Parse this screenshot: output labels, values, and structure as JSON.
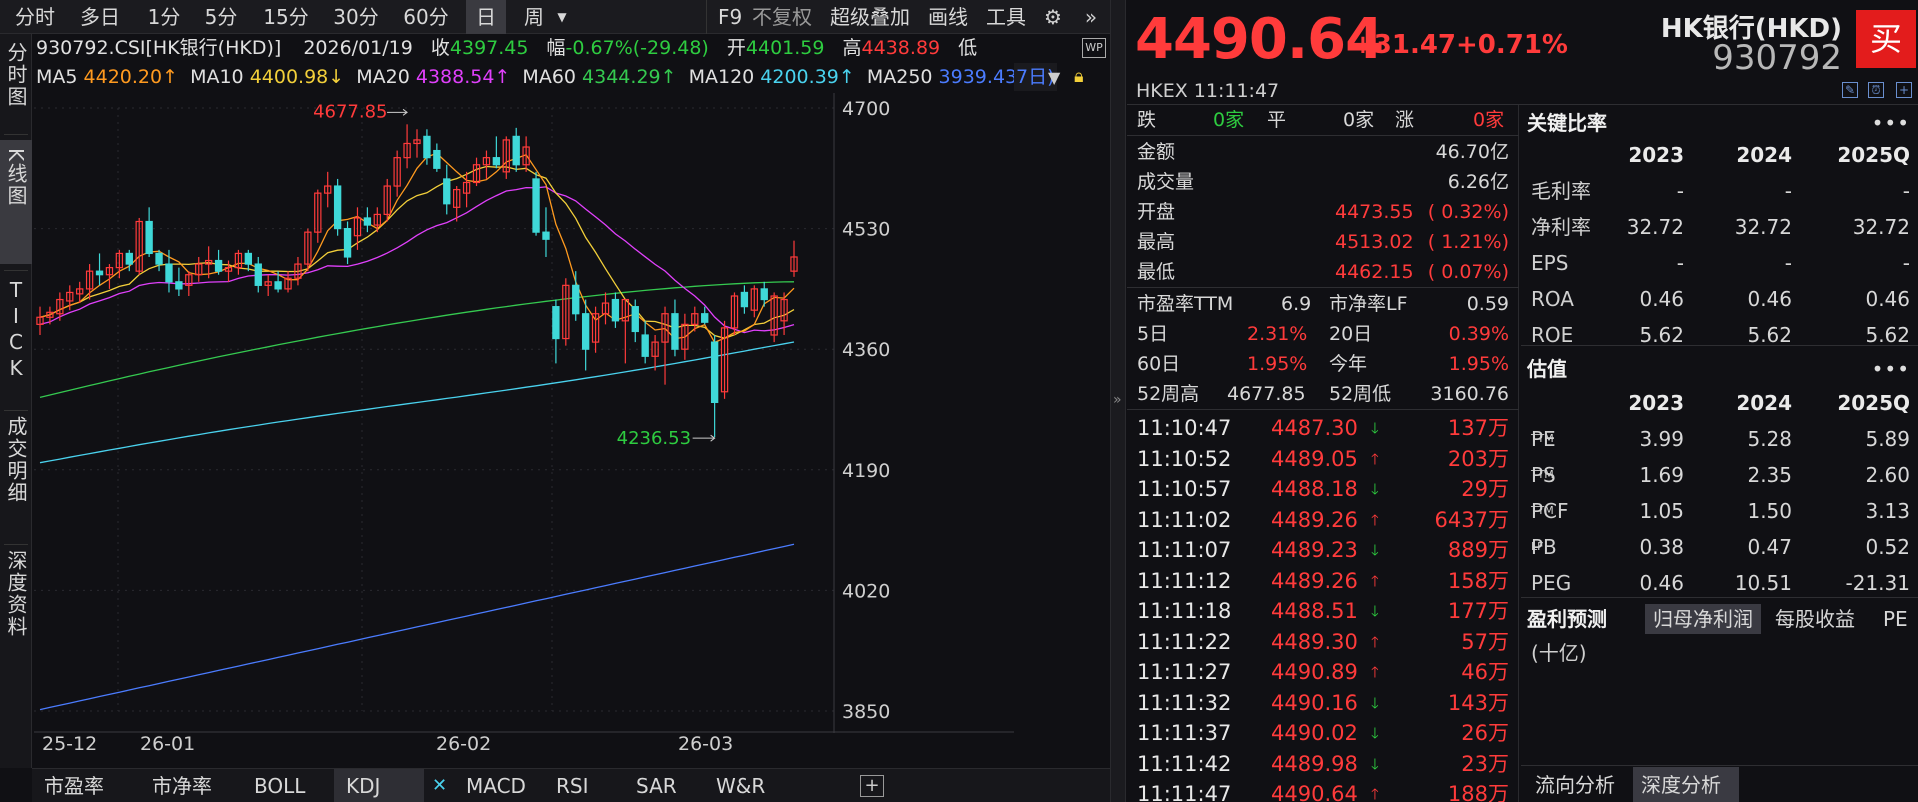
{
  "toolbar": {
    "periods": [
      "分时",
      "多日",
      "1分",
      "5分",
      "15分",
      "30分",
      "60分",
      "日",
      "周"
    ],
    "active_period": "日",
    "f9": "F9",
    "restore": "不复权",
    "overlay": "超级叠加",
    "draw": "画线",
    "tools": "工具"
  },
  "side_tabs": [
    "分时图",
    "K线图",
    "TICK",
    "成交明细",
    "深度资料"
  ],
  "info_line": {
    "code": "930792.CSI[HK银行(HKD)]",
    "date": "2026/01/19",
    "close_label": "收",
    "close": "4397.45",
    "range_label": "幅",
    "range": "-0.67%(-29.48)",
    "open_label": "开",
    "open": "4401.59",
    "high_label": "高",
    "high": "4438.89",
    "low_label": "低"
  },
  "ma_line": {
    "ma5_label": "MA5",
    "ma5": "4420.20↑",
    "ma10_label": "MA10",
    "ma10": "4400.98↓",
    "ma20_label": "MA20",
    "ma20": "4388.54↑",
    "ma60_label": "MA60",
    "ma60": "4344.29↑",
    "ma120_label": "MA120",
    "ma120": "4200.39↑",
    "ma250_label": "MA250",
    "ma250": "3939.43↑",
    "tail": "7日)"
  },
  "colors": {
    "red": "#ff3b3b",
    "green": "#2ecc40",
    "ma5": "#ff9a1f",
    "ma10": "#f2cf3a",
    "ma20": "#e040fb",
    "ma60": "#35c950",
    "ma120": "#4ad2ee",
    "ma250": "#4b7cff",
    "candle_up": "#ff3b3b",
    "candle_down": "#3fd8d8"
  },
  "chart_data": {
    "type": "candlestick",
    "y_ticks": [
      "4700",
      "4530",
      "4360",
      "4190",
      "4020",
      "3850"
    ],
    "ylim": [
      3850,
      4700
    ],
    "x_ticks": [
      "25-12",
      "26-01",
      "26-02",
      "26-03"
    ],
    "max_label": "4677.85",
    "min_label": "4236.53",
    "candles": [
      {
        "o": 4395,
        "h": 4420,
        "l": 4380,
        "c": 4405
      },
      {
        "o": 4405,
        "h": 4420,
        "l": 4395,
        "c": 4412
      },
      {
        "o": 4410,
        "h": 4440,
        "l": 4400,
        "c": 4430
      },
      {
        "o": 4428,
        "h": 4450,
        "l": 4415,
        "c": 4440
      },
      {
        "o": 4438,
        "h": 4455,
        "l": 4425,
        "c": 4445
      },
      {
        "o": 4445,
        "h": 4480,
        "l": 4430,
        "c": 4470
      },
      {
        "o": 4470,
        "h": 4495,
        "l": 4450,
        "c": 4465
      },
      {
        "o": 4465,
        "h": 4480,
        "l": 4445,
        "c": 4475
      },
      {
        "o": 4475,
        "h": 4500,
        "l": 4460,
        "c": 4495
      },
      {
        "o": 4495,
        "h": 4500,
        "l": 4470,
        "c": 4480
      },
      {
        "o": 4470,
        "h": 4545,
        "l": 4465,
        "c": 4540
      },
      {
        "o": 4540,
        "h": 4560,
        "l": 4490,
        "c": 4495
      },
      {
        "o": 4495,
        "h": 4500,
        "l": 4470,
        "c": 4480
      },
      {
        "o": 4480,
        "h": 4500,
        "l": 4440,
        "c": 4455
      },
      {
        "o": 4455,
        "h": 4475,
        "l": 4435,
        "c": 4445
      },
      {
        "o": 4450,
        "h": 4470,
        "l": 4435,
        "c": 4465
      },
      {
        "o": 4465,
        "h": 4490,
        "l": 4455,
        "c": 4480
      },
      {
        "o": 4480,
        "h": 4505,
        "l": 4460,
        "c": 4485
      },
      {
        "o": 4485,
        "h": 4500,
        "l": 4465,
        "c": 4470
      },
      {
        "o": 4470,
        "h": 4485,
        "l": 4455,
        "c": 4475
      },
      {
        "o": 4475,
        "h": 4500,
        "l": 4465,
        "c": 4495
      },
      {
        "o": 4495,
        "h": 4500,
        "l": 4470,
        "c": 4480
      },
      {
        "o": 4480,
        "h": 4490,
        "l": 4440,
        "c": 4450
      },
      {
        "o": 4450,
        "h": 4465,
        "l": 4435,
        "c": 4455
      },
      {
        "o": 4455,
        "h": 4470,
        "l": 4440,
        "c": 4445
      },
      {
        "o": 4445,
        "h": 4470,
        "l": 4440,
        "c": 4460
      },
      {
        "o": 4460,
        "h": 4490,
        "l": 4450,
        "c": 4480
      },
      {
        "o": 4480,
        "h": 4530,
        "l": 4470,
        "c": 4525
      },
      {
        "o": 4525,
        "h": 4585,
        "l": 4510,
        "c": 4580
      },
      {
        "o": 4580,
        "h": 4610,
        "l": 4560,
        "c": 4590
      },
      {
        "o": 4590,
        "h": 4600,
        "l": 4520,
        "c": 4530
      },
      {
        "o": 4530,
        "h": 4540,
        "l": 4480,
        "c": 4490
      },
      {
        "o": 4520,
        "h": 4560,
        "l": 4500,
        "c": 4545
      },
      {
        "o": 4545,
        "h": 4560,
        "l": 4525,
        "c": 4535
      },
      {
        "o": 4535,
        "h": 4560,
        "l": 4525,
        "c": 4550
      },
      {
        "o": 4550,
        "h": 4600,
        "l": 4540,
        "c": 4590
      },
      {
        "o": 4590,
        "h": 4640,
        "l": 4575,
        "c": 4630
      },
      {
        "o": 4630,
        "h": 4677,
        "l": 4615,
        "c": 4650
      },
      {
        "o": 4650,
        "h": 4670,
        "l": 4630,
        "c": 4655
      },
      {
        "o": 4660,
        "h": 4670,
        "l": 4620,
        "c": 4630
      },
      {
        "o": 4640,
        "h": 4650,
        "l": 4610,
        "c": 4615
      },
      {
        "o": 4600,
        "h": 4620,
        "l": 4550,
        "c": 4565
      },
      {
        "o": 4560,
        "h": 4590,
        "l": 4540,
        "c": 4585
      },
      {
        "o": 4580,
        "h": 4610,
        "l": 4560,
        "c": 4595
      },
      {
        "o": 4595,
        "h": 4630,
        "l": 4590,
        "c": 4620
      },
      {
        "o": 4620,
        "h": 4640,
        "l": 4600,
        "c": 4630
      },
      {
        "o": 4630,
        "h": 4660,
        "l": 4615,
        "c": 4620
      },
      {
        "o": 4610,
        "h": 4660,
        "l": 4600,
        "c": 4655
      },
      {
        "o": 4660,
        "h": 4672,
        "l": 4610,
        "c": 4620
      },
      {
        "o": 4620,
        "h": 4660,
        "l": 4610,
        "c": 4645
      },
      {
        "o": 4600,
        "h": 4610,
        "l": 4520,
        "c": 4525
      },
      {
        "o": 4525,
        "h": 4560,
        "l": 4490,
        "c": 4515
      },
      {
        "o": 4420,
        "h": 4430,
        "l": 4340,
        "c": 4375
      },
      {
        "o": 4375,
        "h": 4460,
        "l": 4365,
        "c": 4450
      },
      {
        "o": 4450,
        "h": 4470,
        "l": 4400,
        "c": 4410
      },
      {
        "o": 4410,
        "h": 4430,
        "l": 4330,
        "c": 4360
      },
      {
        "o": 4370,
        "h": 4420,
        "l": 4355,
        "c": 4410
      },
      {
        "o": 4410,
        "h": 4440,
        "l": 4395,
        "c": 4425
      },
      {
        "o": 4430,
        "h": 4440,
        "l": 4390,
        "c": 4400
      },
      {
        "o": 4400,
        "h": 4430,
        "l": 4340,
        "c": 4430
      },
      {
        "o": 4420,
        "h": 4430,
        "l": 4370,
        "c": 4385
      },
      {
        "o": 4380,
        "h": 4400,
        "l": 4340,
        "c": 4350
      },
      {
        "o": 4350,
        "h": 4380,
        "l": 4330,
        "c": 4370
      },
      {
        "o": 4370,
        "h": 4420,
        "l": 4310,
        "c": 4410
      },
      {
        "o": 4410,
        "h": 4430,
        "l": 4350,
        "c": 4360
      },
      {
        "o": 4360,
        "h": 4410,
        "l": 4345,
        "c": 4395
      },
      {
        "o": 4395,
        "h": 4420,
        "l": 4385,
        "c": 4410
      },
      {
        "o": 4410,
        "h": 4420,
        "l": 4395,
        "c": 4398
      },
      {
        "o": 4370,
        "h": 4380,
        "l": 4236,
        "c": 4285
      },
      {
        "o": 4300,
        "h": 4400,
        "l": 4290,
        "c": 4390
      },
      {
        "o": 4390,
        "h": 4440,
        "l": 4380,
        "c": 4435
      },
      {
        "o": 4440,
        "h": 4450,
        "l": 4410,
        "c": 4420
      },
      {
        "o": 4415,
        "h": 4450,
        "l": 4405,
        "c": 4445
      },
      {
        "o": 4445,
        "h": 4455,
        "l": 4420,
        "c": 4430
      },
      {
        "o": 4380,
        "h": 4440,
        "l": 4370,
        "c": 4435
      },
      {
        "o": 4400,
        "h": 4440,
        "l": 4380,
        "c": 4430
      },
      {
        "o": 4470,
        "h": 4513,
        "l": 4462,
        "c": 4490
      }
    ]
  },
  "bottom_tabs": [
    "市盈率",
    "市净率",
    "BOLL",
    "KDJ",
    "MACD",
    "RSI",
    "SAR",
    "W&R"
  ],
  "active_bottom_tab": "KDJ",
  "quote": {
    "price": "4490.64",
    "change": "+31.47",
    "pct": "+0.71%",
    "exchange": "HKEX  11:11:47",
    "name": "HK银行(HKD)",
    "code": "930792",
    "buy": "买"
  },
  "stats": {
    "down_label": "跌",
    "down": "0家",
    "flat_label": "平",
    "flat": "0家",
    "up_label": "涨",
    "up": "0家",
    "amount_label": "金额",
    "amount": "46.70亿",
    "volume_label": "成交量",
    "volume": "6.26亿",
    "open_label": "开盘",
    "open": "4473.55",
    "open_pct": "( 0.32%)",
    "high_label": "最高",
    "high": "4513.02",
    "high_pct": "( 1.21%)",
    "low_label": "最低",
    "low": "4462.15",
    "low_pct": "( 0.07%)",
    "pe_label": "市盈率TTM",
    "pe": "6.9",
    "pb_label": "市净率LF",
    "pb": "0.59",
    "d5_label": "5日",
    "d5": "2.31%",
    "d20_label": "20日",
    "d20": "0.39%",
    "d60_label": "60日",
    "d60": "1.95%",
    "ytd_label": "今年",
    "ytd": "1.95%",
    "w52h_label": "52周高",
    "w52h": "4677.85",
    "w52l_label": "52周低",
    "w52l": "3160.76"
  },
  "ticks": [
    {
      "t": "11:10:47",
      "p": "4487.30",
      "dir": "down",
      "v": "137万"
    },
    {
      "t": "11:10:52",
      "p": "4489.05",
      "dir": "up",
      "v": "203万"
    },
    {
      "t": "11:10:57",
      "p": "4488.18",
      "dir": "down",
      "v": "29万"
    },
    {
      "t": "11:11:02",
      "p": "4489.26",
      "dir": "up",
      "v": "6437万"
    },
    {
      "t": "11:11:07",
      "p": "4489.23",
      "dir": "down",
      "v": "889万"
    },
    {
      "t": "11:11:12",
      "p": "4489.26",
      "dir": "up",
      "v": "158万"
    },
    {
      "t": "11:11:18",
      "p": "4488.51",
      "dir": "down",
      "v": "177万"
    },
    {
      "t": "11:11:22",
      "p": "4489.30",
      "dir": "up",
      "v": "57万"
    },
    {
      "t": "11:11:27",
      "p": "4490.89",
      "dir": "up",
      "v": "46万"
    },
    {
      "t": "11:11:32",
      "p": "4490.16",
      "dir": "down",
      "v": "143万"
    },
    {
      "t": "11:11:37",
      "p": "4490.02",
      "dir": "down",
      "v": "26万"
    },
    {
      "t": "11:11:42",
      "p": "4489.98",
      "dir": "down",
      "v": "23万"
    },
    {
      "t": "11:11:47",
      "p": "4490.64",
      "dir": "up",
      "v": "188万"
    }
  ],
  "ratios": {
    "title": "关键比率",
    "years": [
      "2023",
      "2024",
      "2025Q"
    ],
    "rows": [
      {
        "label": "毛利率",
        "v": [
          "-",
          "-",
          "-"
        ]
      },
      {
        "label": "净利率",
        "v": [
          "32.72",
          "32.72",
          "32.72"
        ]
      },
      {
        "label": "EPS",
        "v": [
          "-",
          "-",
          "-"
        ]
      },
      {
        "label": "ROA",
        "v": [
          "0.46",
          "0.46",
          "0.46"
        ]
      },
      {
        "label": "ROE",
        "v": [
          "5.62",
          "5.62",
          "5.62"
        ]
      }
    ]
  },
  "valuation": {
    "title": "估值",
    "years": [
      "2023",
      "2024",
      "2025Q"
    ],
    "rows": [
      {
        "label": "PE",
        "sup": "TTM",
        "v": [
          "3.99",
          "5.28",
          "5.89"
        ]
      },
      {
        "label": "PS",
        "sup": "TTM",
        "v": [
          "1.69",
          "2.35",
          "2.60"
        ]
      },
      {
        "label": "PCF",
        "sup": "TTM",
        "v": [
          "1.05",
          "1.50",
          "3.13"
        ]
      },
      {
        "label": "PB",
        "sup": "LF",
        "v": [
          "0.38",
          "0.47",
          "0.52"
        ]
      },
      {
        "label": "PEG",
        "sup": "",
        "v": [
          "0.46",
          "10.51",
          "-21.31"
        ]
      }
    ]
  },
  "forecast": {
    "title": "盈利预测",
    "tabs": [
      "归母净利润",
      "每股收益",
      "PE"
    ],
    "unit": "(十亿)"
  },
  "footer_tabs": [
    "流向分析",
    "深度分析"
  ]
}
